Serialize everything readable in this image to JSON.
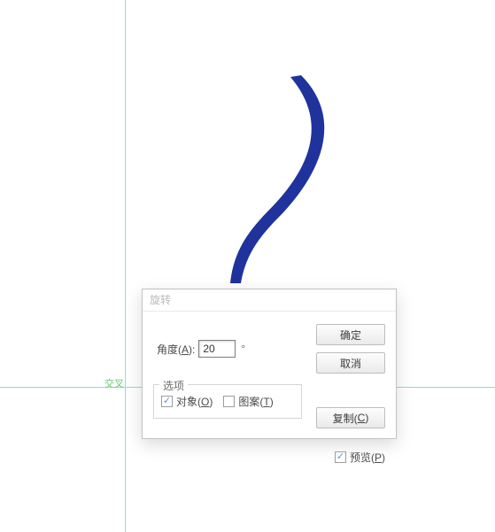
{
  "canvas": {
    "intersection_label": "交叉"
  },
  "dialog": {
    "title": "旋转",
    "angle": {
      "label_pre": "角度(",
      "label_hot": "A",
      "label_post": "):",
      "value": "20",
      "degree_glyph": "°"
    },
    "options": {
      "legend": "选项",
      "objects": {
        "label_pre": "对象(",
        "hot": "O",
        "label_post": ")",
        "checked": true
      },
      "patterns": {
        "label_pre": "图案(",
        "hot": "T",
        "label_post": ")",
        "checked": false
      }
    },
    "buttons": {
      "ok": "确定",
      "cancel": "取消",
      "copy_pre": "复制(",
      "copy_hot": "C",
      "copy_post": ")"
    },
    "preview": {
      "label_pre": "预览(",
      "hot": "P",
      "label_post": ")",
      "checked": true
    }
  },
  "watermark": ""
}
